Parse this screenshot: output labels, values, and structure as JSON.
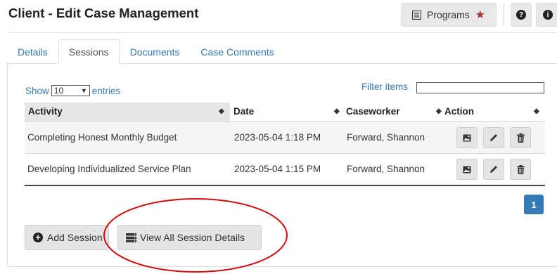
{
  "page": {
    "title": "Client - Edit Case Management"
  },
  "toolbar": {
    "programs_label": "Programs",
    "programs_star": "★",
    "help_glyph": "?",
    "info_glyph": "i"
  },
  "tabs": [
    {
      "label": "Details",
      "active": false
    },
    {
      "label": "Sessions",
      "active": true
    },
    {
      "label": "Documents",
      "active": false
    },
    {
      "label": "Case Comments",
      "active": false
    }
  ],
  "entries": {
    "show_label": "Show",
    "value": "10",
    "suffix": "entries"
  },
  "filter": {
    "label": "Filter items",
    "value": ""
  },
  "table": {
    "columns": [
      "Activity",
      "Date",
      "Caseworker",
      "Action"
    ],
    "rows": [
      {
        "activity": "Completing Honest Monthly Budget",
        "date": "2023-05-04 1:18 PM",
        "caseworker": "Forward, Shannon"
      },
      {
        "activity": "Developing Individualized Service Plan",
        "date": "2023-05-04 1:15 PM",
        "caseworker": "Forward, Shannon"
      }
    ],
    "action_icons": [
      "image-icon",
      "pencil-icon",
      "trash-icon"
    ]
  },
  "pagination": {
    "current_page": "1"
  },
  "buttons": {
    "add_session": "Add Session",
    "view_all": "View All Session Details"
  },
  "colors": {
    "link": "#337ab7",
    "accent_star": "#a33333",
    "page_active": "#337ab7",
    "annotation": "#d01010"
  }
}
